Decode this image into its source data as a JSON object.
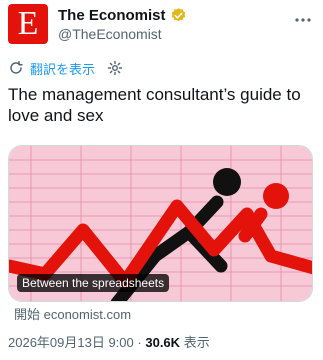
{
  "account": {
    "display_name": "The Economist",
    "handle": "@TheEconomist",
    "avatar_letter": "E",
    "brand_color": "#e3120b",
    "verified_color": "#e2b719"
  },
  "translate": {
    "label": "翻訳を表示",
    "link_color": "#1d9bf0"
  },
  "tweet": {
    "text": "The management consultant’s guide to love and sex"
  },
  "card": {
    "image_caption": "Between the spreadsheets",
    "source_text": "開始 economist.com",
    "illustration_colors": {
      "background": "#f7c9d6",
      "grid": "#e58aa3",
      "red": "#e3120b",
      "black": "#111111"
    }
  },
  "meta": {
    "timestamp": "2026年09月13日 9:00",
    "separator": "·",
    "views_count": "30.6K",
    "views_label": "表示"
  }
}
